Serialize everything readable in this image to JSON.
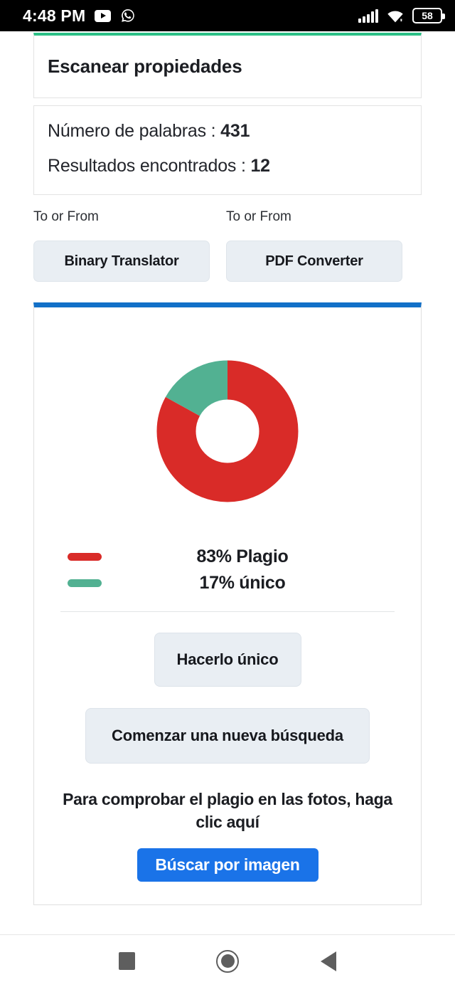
{
  "status_bar": {
    "time": "4:48 PM",
    "youtube_icon": "youtube-icon",
    "whatsapp_icon": "whatsapp-icon",
    "signal_icon": "signal-bars-icon",
    "wifi_icon": "wifi-icon",
    "battery_level": "58"
  },
  "title_card": {
    "title": "Escanear propiedades",
    "accent_color": "#2bbf85"
  },
  "stats_card": {
    "word_count_label": "Número de palabras : ",
    "word_count_value": "431",
    "results_label": "Resultados encontrados : ",
    "results_value": "12"
  },
  "tools": [
    {
      "label": "To or From",
      "button": "Binary Translator"
    },
    {
      "label": "To or From",
      "button": "PDF Converter"
    }
  ],
  "result_card": {
    "accent_color": "#1270c8",
    "legend": [
      {
        "text": "83% Plagio",
        "color": "#d92b28"
      },
      {
        "text": "17% único",
        "color": "#52b192"
      }
    ],
    "make_unique_button": "Hacerlo único",
    "new_search_button": "Comenzar una nueva búsqueda",
    "photo_prompt": "Para comprobar el plagio en las fotos, haga clic aquí",
    "image_search_button": "Búscar por imagen",
    "image_search_color": "#1a73e8"
  },
  "chart_data": {
    "type": "pie",
    "title": "",
    "variant": "donut",
    "categories": [
      "Plagio",
      "único"
    ],
    "values": [
      83,
      17
    ],
    "unit": "%",
    "colors": [
      "#d92b28",
      "#52b192"
    ],
    "start_angle_deg": 0,
    "direction": "clockwise",
    "inner_radius_ratio": 0.58,
    "legend_position": "bottom",
    "labels": [
      "83% Plagio",
      "17% único"
    ],
    "grid": false
  },
  "nav_bar": {
    "recents_icon": "square-recents-icon",
    "home_icon": "circle-home-icon",
    "back_icon": "triangle-back-icon"
  }
}
